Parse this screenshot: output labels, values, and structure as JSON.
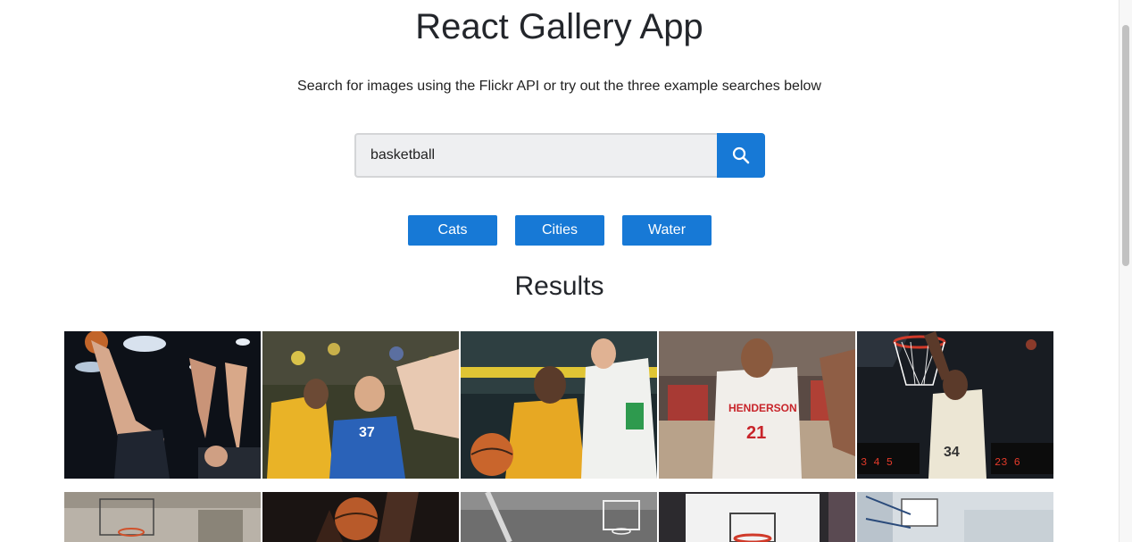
{
  "header": {
    "title": "React Gallery App",
    "subtitle": "Search for images using the Flickr API or try out the three example searches below"
  },
  "search": {
    "value": "basketball",
    "placeholder": "Search"
  },
  "nav": {
    "buttons": [
      "Cats",
      "Cities",
      "Water"
    ]
  },
  "results": {
    "heading": "Results"
  },
  "colors": {
    "accent": "#1779d6",
    "text": "#23262b",
    "input_bg": "#eeeff1"
  },
  "icons": {
    "search_button": "search-icon"
  },
  "photos": [
    {
      "description": "player in black jersey number 15 shooting over defenders"
    },
    {
      "description": "player in blue Leeds jersey driving past yellow defender"
    },
    {
      "description": "player in yellow jersey dribbling against white jersey defender"
    },
    {
      "description": "player in white Henderson State jersey number 21 dribbling"
    },
    {
      "description": "player in white jersey number 34 dunking"
    },
    {
      "description": "basketball hoop in gymnasium"
    },
    {
      "description": "hands reaching for basketball"
    },
    {
      "description": "black and white basketball hoop"
    },
    {
      "description": "basketball hoop with red rim"
    },
    {
      "description": "indoor court with backboard"
    }
  ]
}
